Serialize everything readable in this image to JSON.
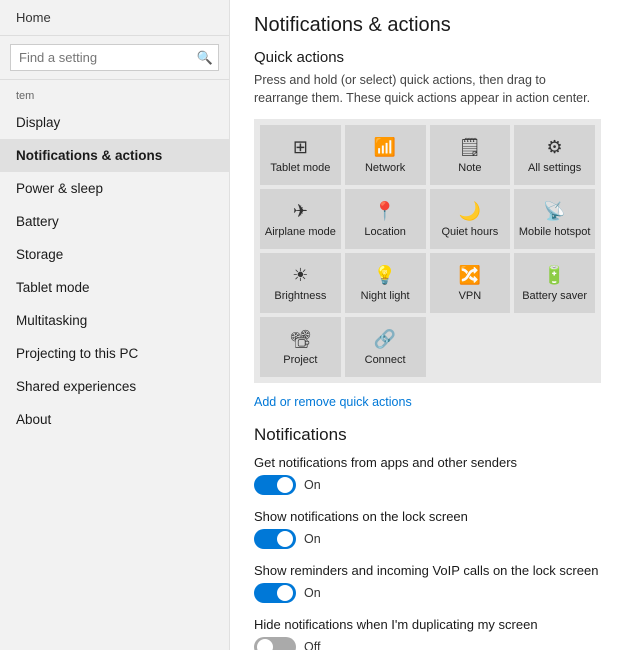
{
  "sidebar": {
    "home_label": "Home",
    "search_placeholder": "Find a setting",
    "section_label": "tem",
    "items": [
      {
        "id": "display",
        "label": "Display",
        "active": false
      },
      {
        "id": "notifications",
        "label": "Notifications & actions",
        "active": true
      },
      {
        "id": "power",
        "label": "Power & sleep",
        "active": false
      },
      {
        "id": "battery",
        "label": "Battery",
        "active": false
      },
      {
        "id": "storage",
        "label": "Storage",
        "active": false
      },
      {
        "id": "tablet",
        "label": "Tablet mode",
        "active": false
      },
      {
        "id": "multitasking",
        "label": "Multitasking",
        "active": false
      },
      {
        "id": "projecting",
        "label": "Projecting to this PC",
        "active": false
      },
      {
        "id": "shared",
        "label": "Shared experiences",
        "active": false
      },
      {
        "id": "about",
        "label": "About",
        "active": false
      }
    ]
  },
  "main": {
    "page_title": "Notifications & actions",
    "quick_actions": {
      "section_title": "Quick actions",
      "description": "Press and hold (or select) quick actions, then drag to rearrange them. These quick actions appear in action center.",
      "items": [
        {
          "icon": "⊞",
          "label": "Tablet mode"
        },
        {
          "icon": "📶",
          "label": "Network"
        },
        {
          "icon": "🗒",
          "label": "Note"
        },
        {
          "icon": "⚙",
          "label": "All settings"
        },
        {
          "icon": "✈",
          "label": "Airplane mode"
        },
        {
          "icon": "📍",
          "label": "Location"
        },
        {
          "icon": "🌙",
          "label": "Quiet hours"
        },
        {
          "icon": "📡",
          "label": "Mobile hotspot"
        },
        {
          "icon": "☀",
          "label": "Brightness"
        },
        {
          "icon": "💡",
          "label": "Night light"
        },
        {
          "icon": "🔀",
          "label": "VPN"
        },
        {
          "icon": "🔋",
          "label": "Battery saver"
        },
        {
          "icon": "📽",
          "label": "Project"
        },
        {
          "icon": "🔗",
          "label": "Connect"
        }
      ],
      "add_remove_label": "Add or remove quick actions"
    },
    "notifications": {
      "section_title": "Notifications",
      "rows": [
        {
          "id": "apps-notif",
          "label": "Get notifications from apps and other senders",
          "state": "on",
          "state_label": "On"
        },
        {
          "id": "lock-screen",
          "label": "Show notifications on the lock screen",
          "state": "on",
          "state_label": "On"
        },
        {
          "id": "voip",
          "label": "Show reminders and incoming VoIP calls on the lock screen",
          "state": "on",
          "state_label": "On"
        },
        {
          "id": "duplicate",
          "label": "Hide notifications when I'm duplicating my screen",
          "state": "off",
          "state_label": "Off"
        }
      ]
    }
  }
}
